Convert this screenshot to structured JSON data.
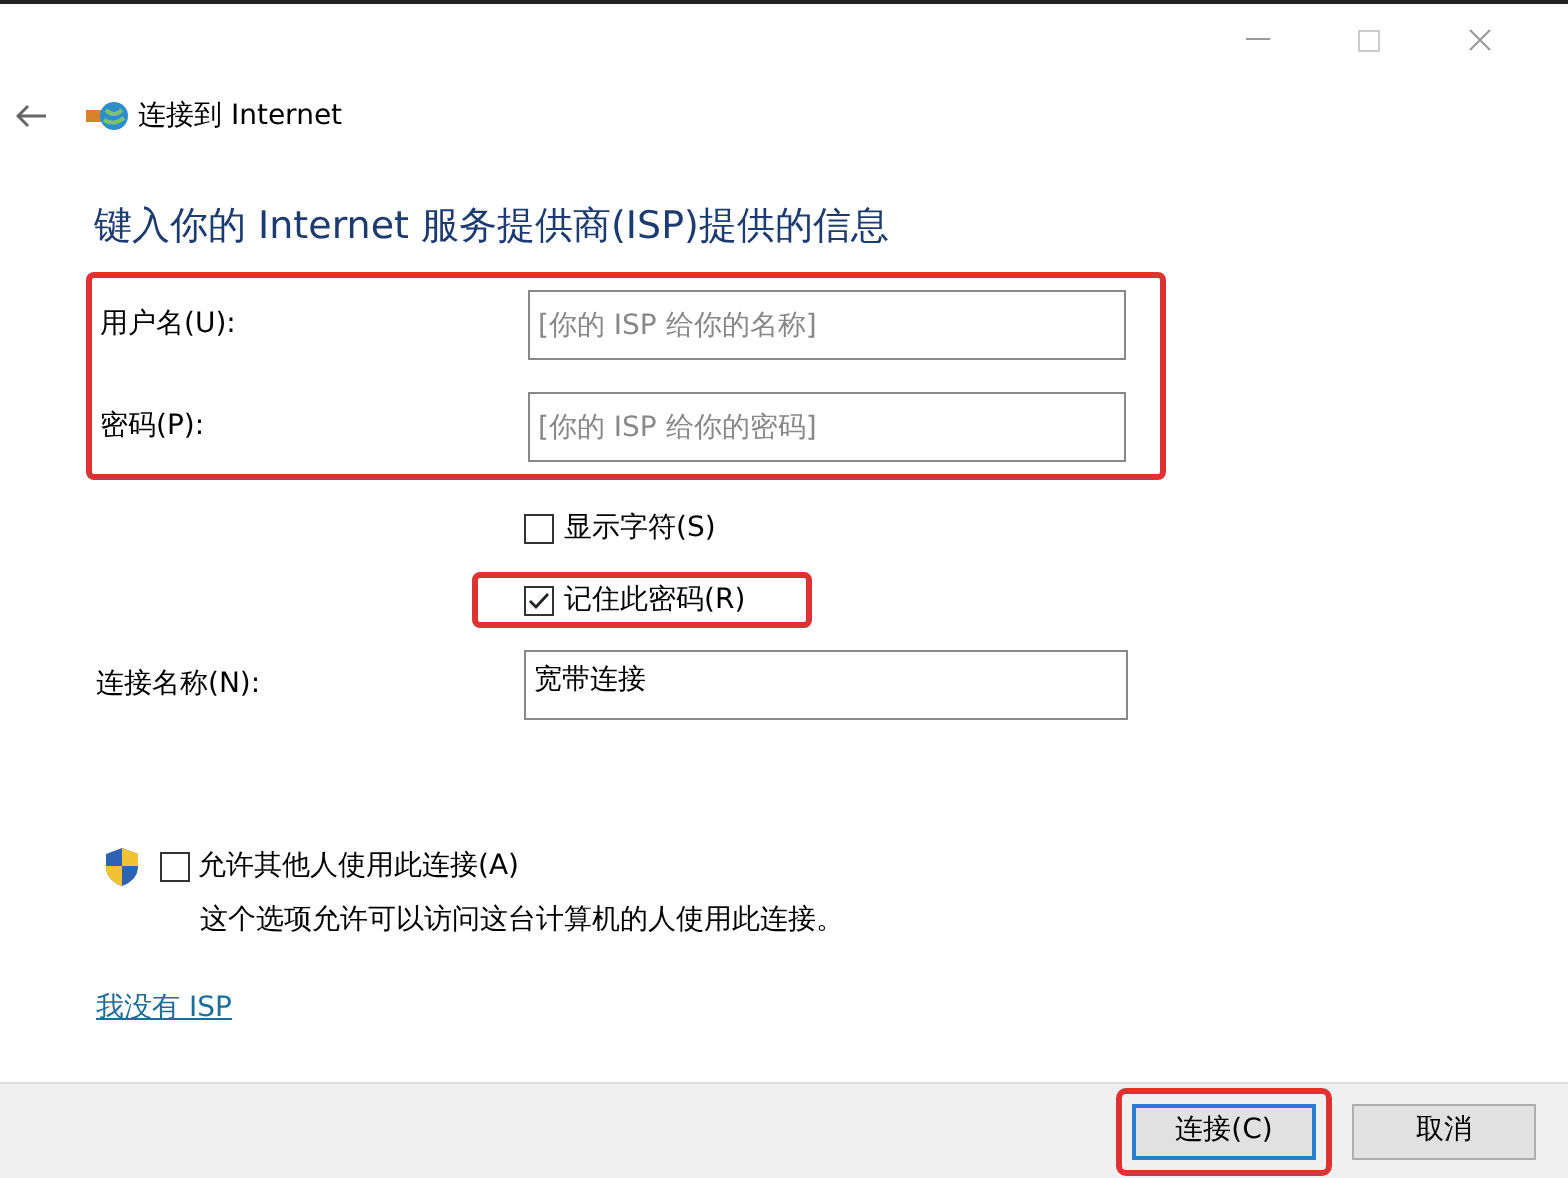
{
  "window": {
    "title": "连接到 Internet"
  },
  "heading": "键入你的 Internet 服务提供商(ISP)提供的信息",
  "credentials": {
    "highlighted": true,
    "fields": [
      {
        "label": "用户名(U):",
        "placeholder": "[你的 ISP 给你的名称]"
      },
      {
        "label": "密码(P):",
        "placeholder": "[你的 ISP 给你的密码]"
      }
    ]
  },
  "options": [
    {
      "label": "显示字符(S)",
      "checked": false,
      "highlighted": false
    },
    {
      "label": "记住此密码(R)",
      "checked": true,
      "highlighted": true
    }
  ],
  "connection_name": {
    "label": "连接名称(N):",
    "value": "宽带连接"
  },
  "share": {
    "label": "允许其他人使用此连接(A)",
    "checked": false,
    "description": "这个选项允许可以访问这台计算机的人使用此连接。"
  },
  "link": "我没有 ISP",
  "buttons": [
    {
      "label": "连接(C)",
      "default": true,
      "highlighted": true
    },
    {
      "label": "取消",
      "default": false,
      "highlighted": false
    }
  ]
}
